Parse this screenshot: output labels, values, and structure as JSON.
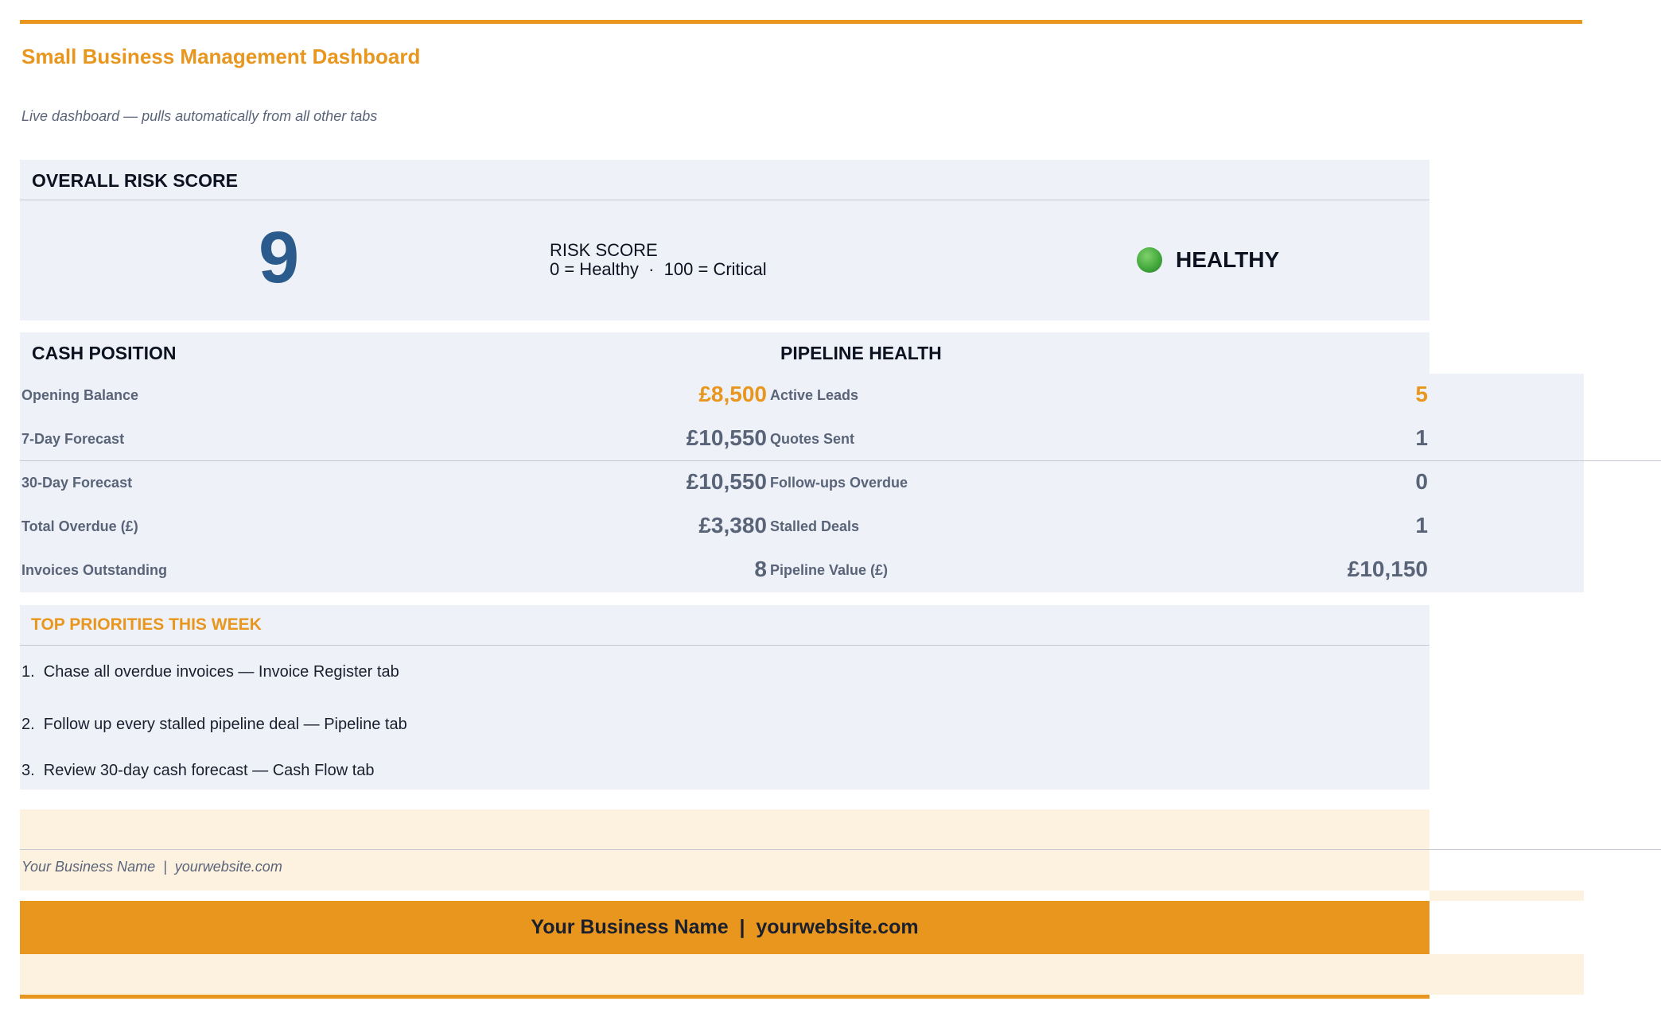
{
  "title": "Small Business Management Dashboard",
  "subtitle": "Live dashboard — pulls automatically from all other tabs",
  "risk": {
    "heading": "OVERALL RISK SCORE",
    "score": "9",
    "label": "RISK SCORE",
    "scale": "0 = Healthy  ·  100 = Critical",
    "status_icon": "green-circle-icon",
    "status": "HEALTHY",
    "status_color": "#3fa53a"
  },
  "cash": {
    "heading": "CASH POSITION",
    "rows": [
      {
        "label": "Opening Balance",
        "value": "£8,500"
      },
      {
        "label": "7-Day Forecast",
        "value": "£10,550"
      },
      {
        "label": "30-Day Forecast",
        "value": "£10,550"
      },
      {
        "label": "Total Overdue (£)",
        "value": "£3,380"
      },
      {
        "label": "Invoices Outstanding",
        "value": "8"
      }
    ]
  },
  "pipeline": {
    "heading": "PIPELINE HEALTH",
    "rows": [
      {
        "label": "Active Leads",
        "value": "5"
      },
      {
        "label": "Quotes Sent",
        "value": "1"
      },
      {
        "label": "Follow-ups Overdue",
        "value": "0"
      },
      {
        "label": "Stalled Deals",
        "value": "1"
      },
      {
        "label": "Pipeline Value (£)",
        "value": "£10,150"
      }
    ]
  },
  "priorities": {
    "heading": "TOP PRIORITIES THIS WEEK",
    "items": [
      "1.  Chase all overdue invoices — Invoice Register tab",
      "2.  Follow up every stalled pipeline deal — Pipeline tab",
      "3.  Review 30-day cash forecast — Cash Flow tab"
    ]
  },
  "footer": {
    "small": "Your Business Name  |  yourwebsite.com",
    "banner": "Your Business Name  |  yourwebsite.com"
  },
  "colors": {
    "accent": "#e8961e",
    "panel": "#eef2f8",
    "cream": "#fdf1e0",
    "score_blue": "#2b5b8c"
  }
}
